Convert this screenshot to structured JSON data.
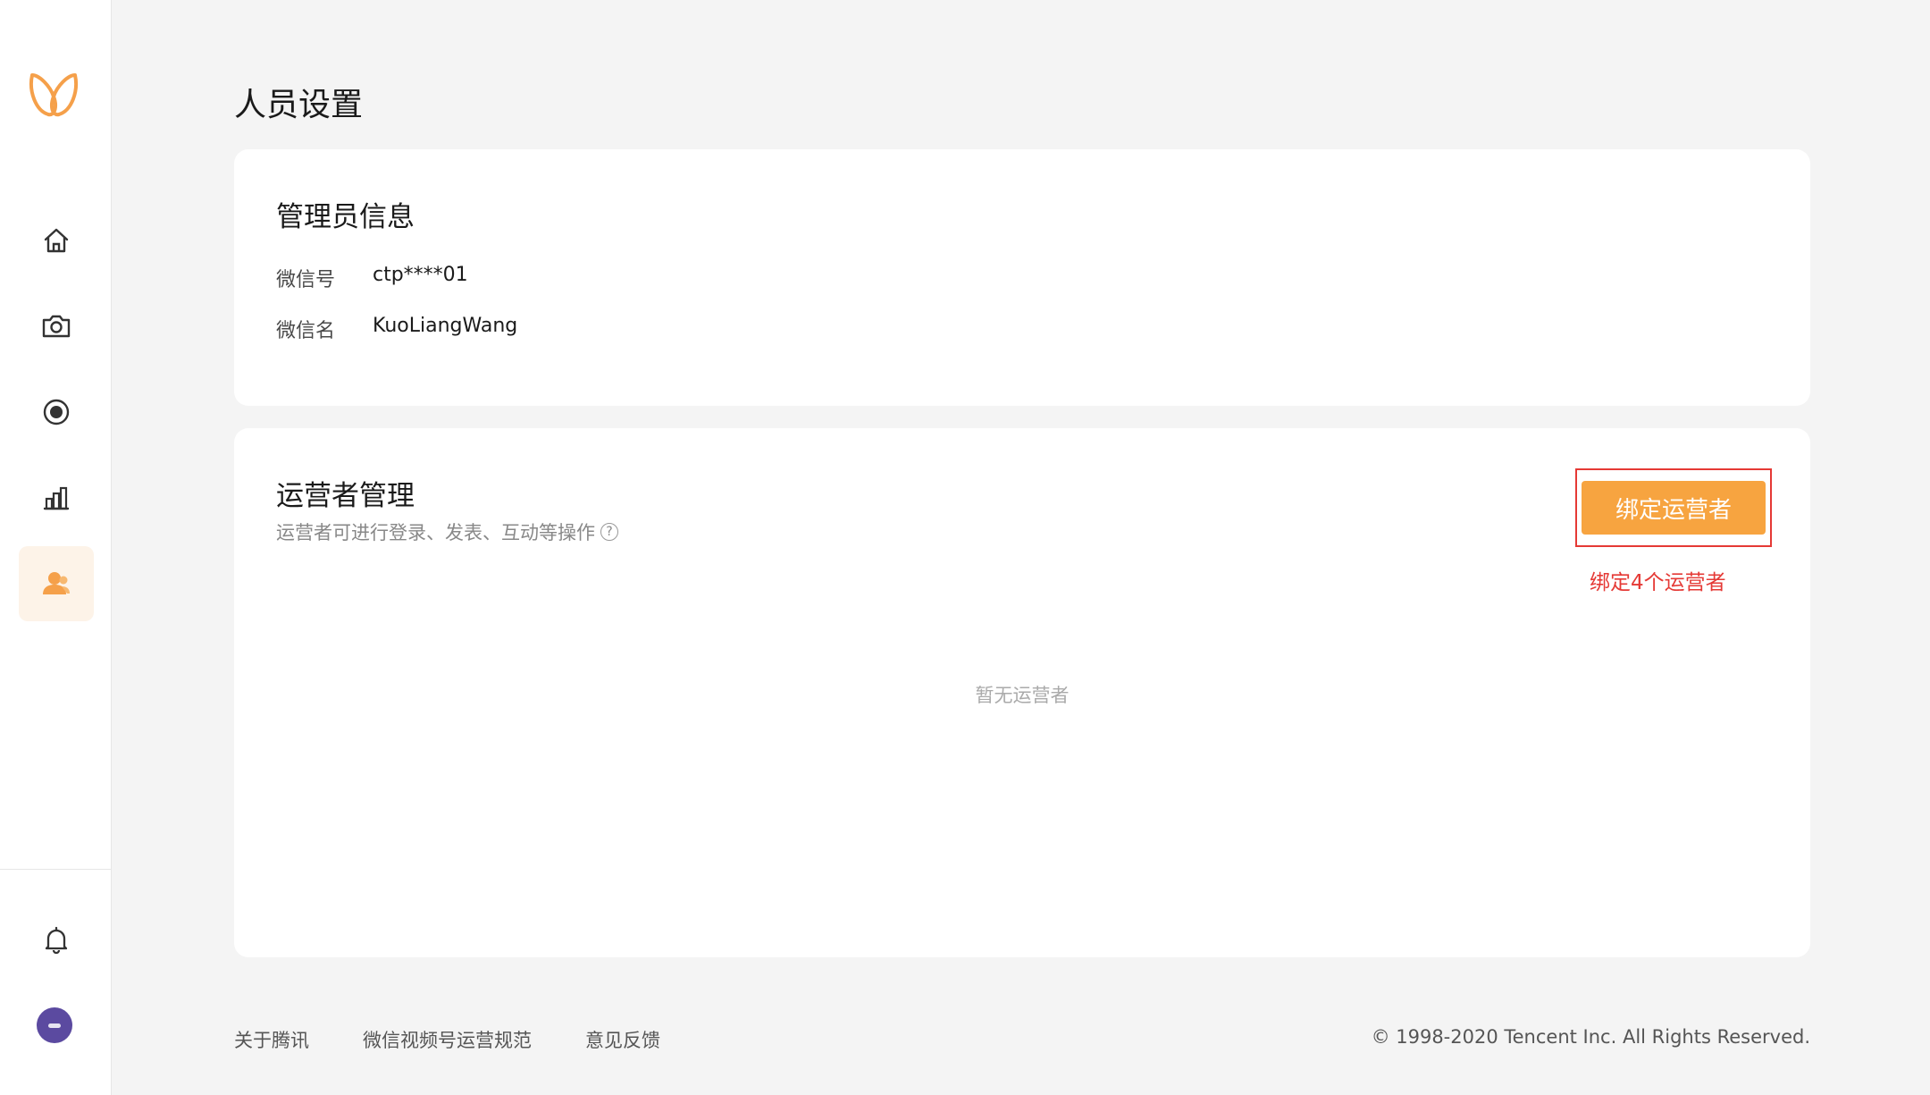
{
  "colors": {
    "accent": "#f7a440",
    "annotation": "#e53935",
    "avatar": "#5b4aa0"
  },
  "sidebar": {
    "logo": "wings-logo-icon",
    "items": [
      {
        "icon": "home-icon",
        "active": false
      },
      {
        "icon": "camera-icon",
        "active": false
      },
      {
        "icon": "live-record-icon",
        "active": false
      },
      {
        "icon": "bar-chart-icon",
        "active": false
      },
      {
        "icon": "user-icon",
        "active": true
      }
    ],
    "bottom": [
      {
        "icon": "bell-icon"
      },
      {
        "icon": "avatar"
      }
    ]
  },
  "page": {
    "title": "人员设置"
  },
  "admin": {
    "title": "管理员信息",
    "rows": [
      {
        "label": "微信号",
        "value": "ctp****01"
      },
      {
        "label": "微信名",
        "value": "KuoLiangWang"
      }
    ]
  },
  "operators": {
    "title": "运营者管理",
    "subtitle": "运营者可进行登录、发表、互动等操作",
    "help_icon": "question-circle-icon",
    "bind_button": "绑定运营者",
    "bind_note": "绑定4个运营者",
    "empty": "暂无运营者"
  },
  "footer": {
    "links": [
      "关于腾讯",
      "微信视频号运营规范",
      "意见反馈"
    ],
    "copyright": "© 1998-2020 Tencent Inc. All Rights Reserved."
  }
}
